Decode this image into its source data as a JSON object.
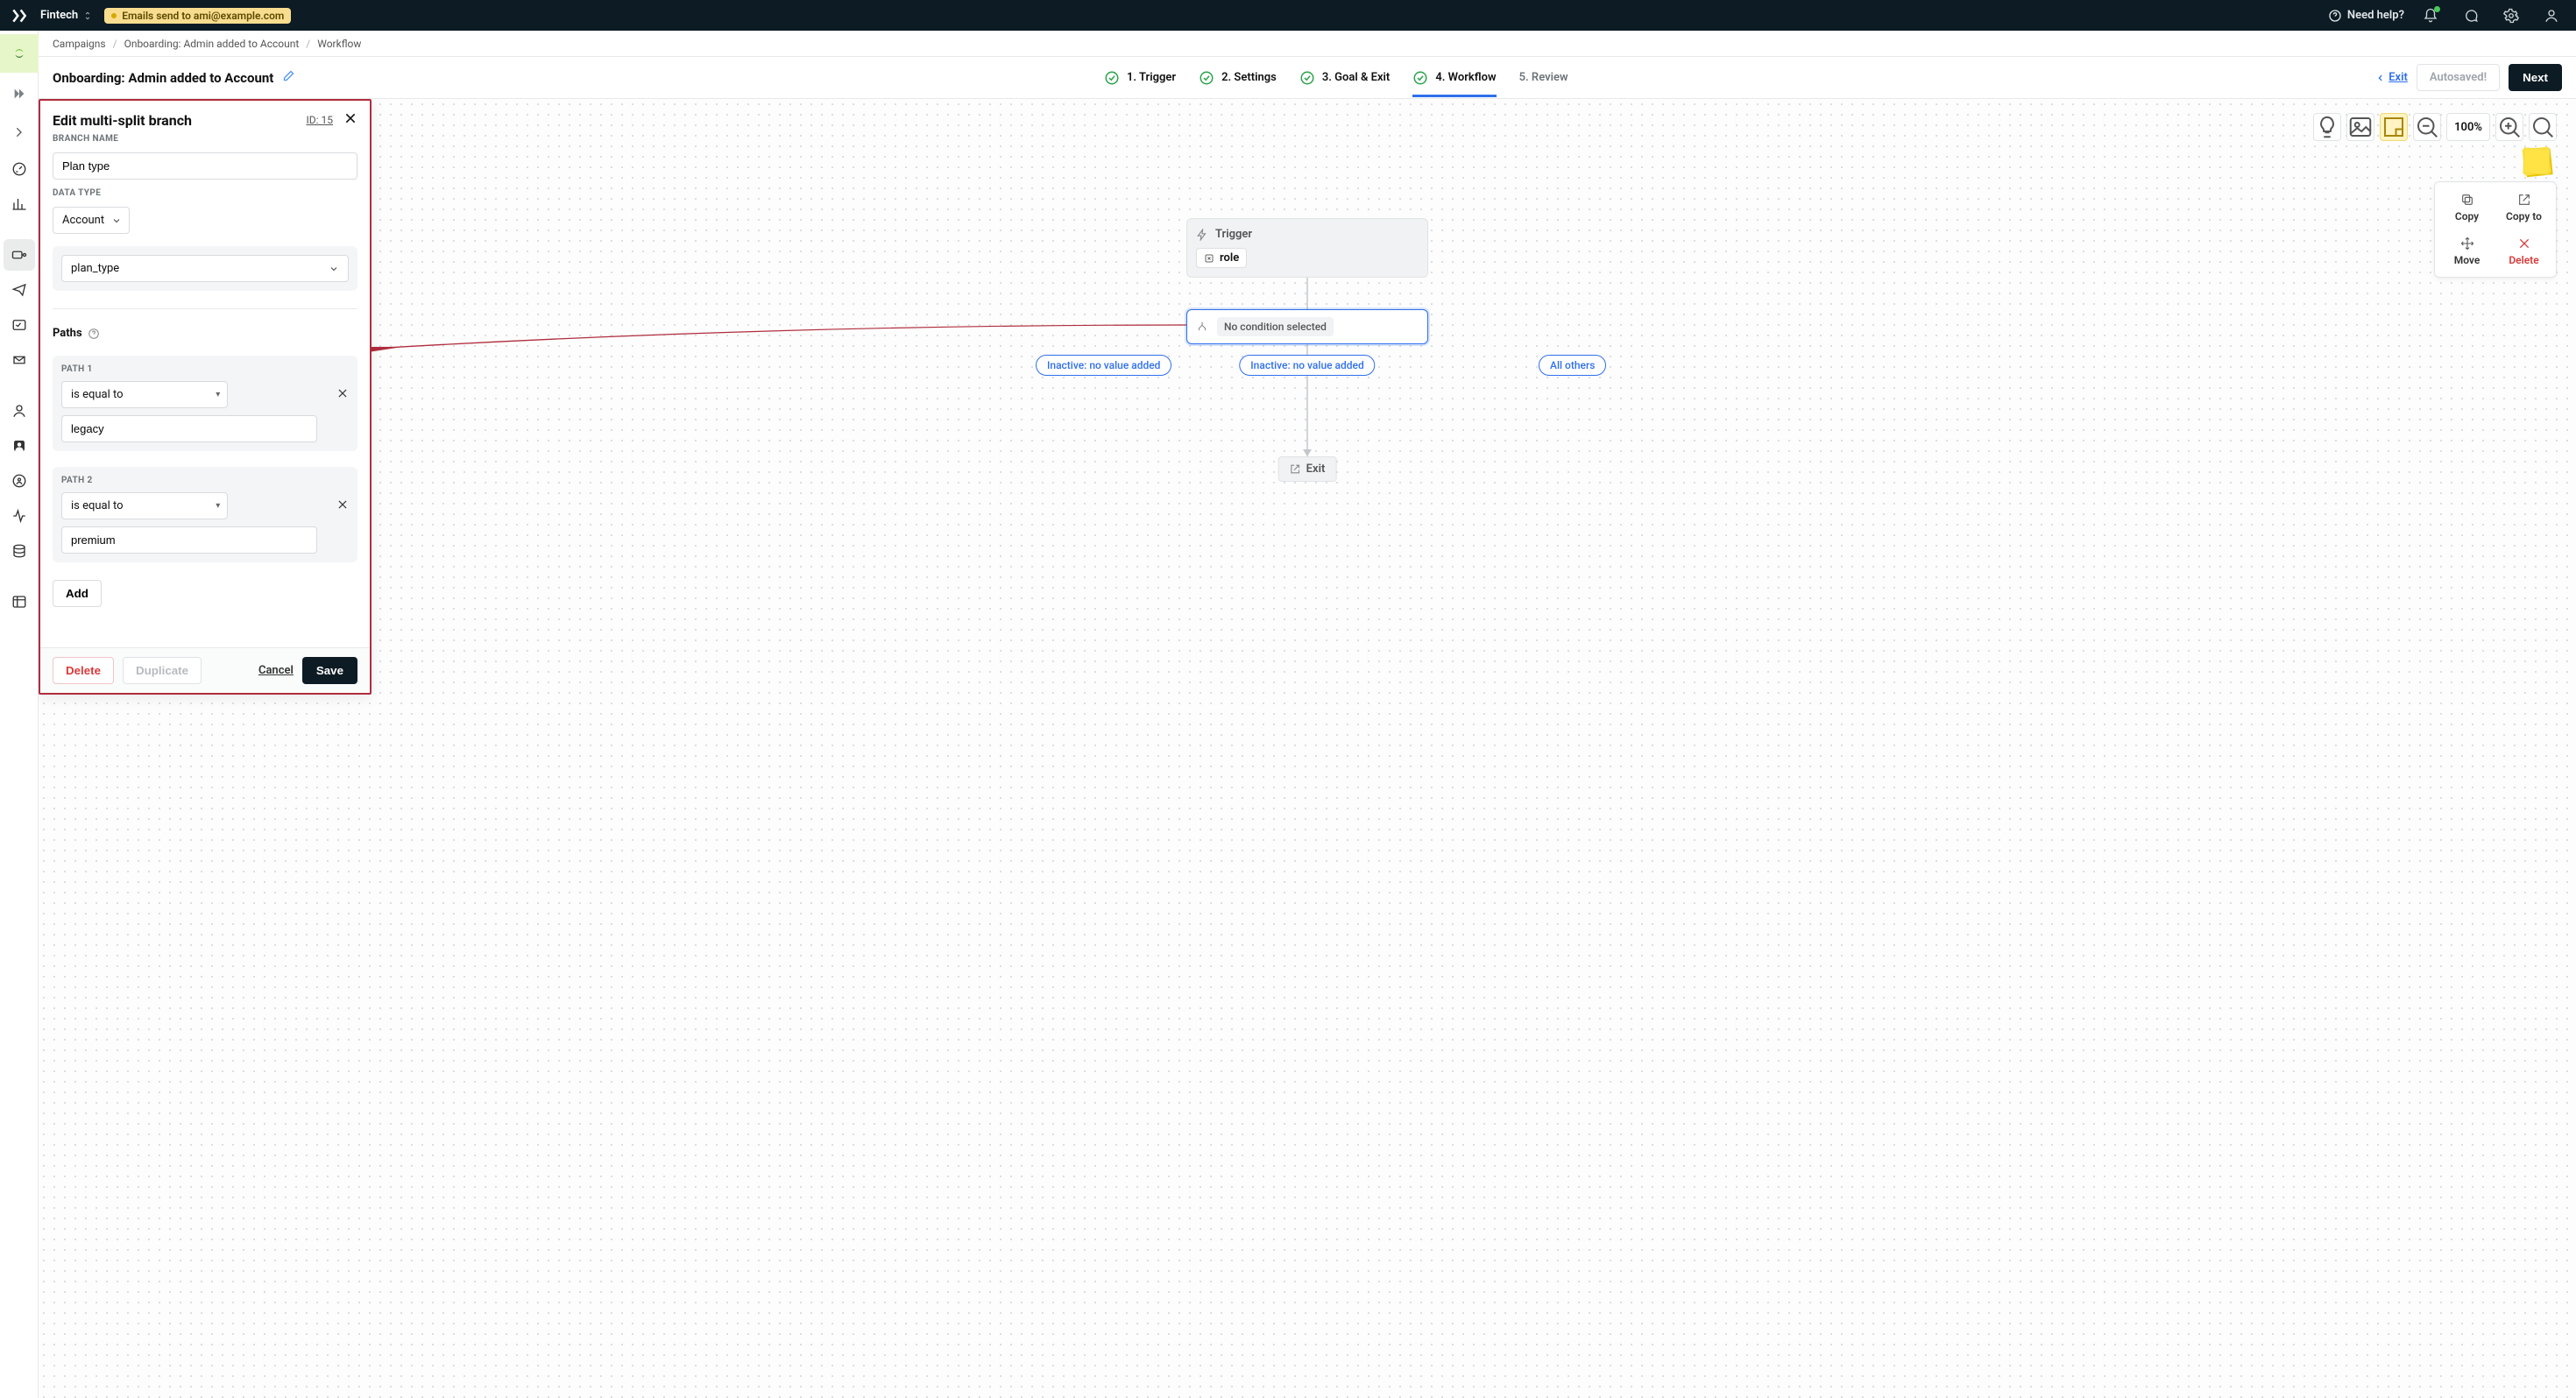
{
  "topbar": {
    "workspace_name": "Fintech",
    "notice_chip": "Emails send to ami@example.com",
    "help_label": "Need help?"
  },
  "breadcrumbs": {
    "campaigns": "Campaigns",
    "campaign_name": "Onboarding: Admin added to Account",
    "current": "Workflow"
  },
  "header": {
    "title": "Onboarding: Admin added to Account",
    "steps": {
      "s1": "1. Trigger",
      "s2": "2. Settings",
      "s3": "3. Goal & Exit",
      "s4": "4. Workflow",
      "s5": "5. Review"
    },
    "exit_label": "Exit",
    "autosaved_label": "Autosaved!",
    "next_label": "Next"
  },
  "canvas": {
    "zoom": "100%",
    "trigger_label": "Trigger",
    "trigger_tag": "role",
    "cond_label": "No condition selected",
    "pill_a": "Inactive: no value added",
    "pill_b": "Inactive: no value added",
    "pill_c": "All others",
    "exit_label": "Exit",
    "context": {
      "copy": "Copy",
      "copy_to": "Copy to",
      "move": "Move",
      "delete": "Delete"
    }
  },
  "panel": {
    "title": "Edit multi-split branch",
    "id_label": "ID: 15",
    "branch_name_label": "BRANCH NAME",
    "branch_name_value": "Plan type",
    "data_type_label": "DATA TYPE",
    "data_type_value": "Account",
    "attribute_value": "plan_type",
    "paths_label": "Paths",
    "paths": [
      {
        "label": "PATH 1",
        "op": "is equal to",
        "value": "legacy"
      },
      {
        "label": "PATH 2",
        "op": "is equal to",
        "value": "premium"
      }
    ],
    "add_label": "Add",
    "delete_label": "Delete",
    "duplicate_label": "Duplicate",
    "cancel_label": "Cancel",
    "save_label": "Save"
  }
}
